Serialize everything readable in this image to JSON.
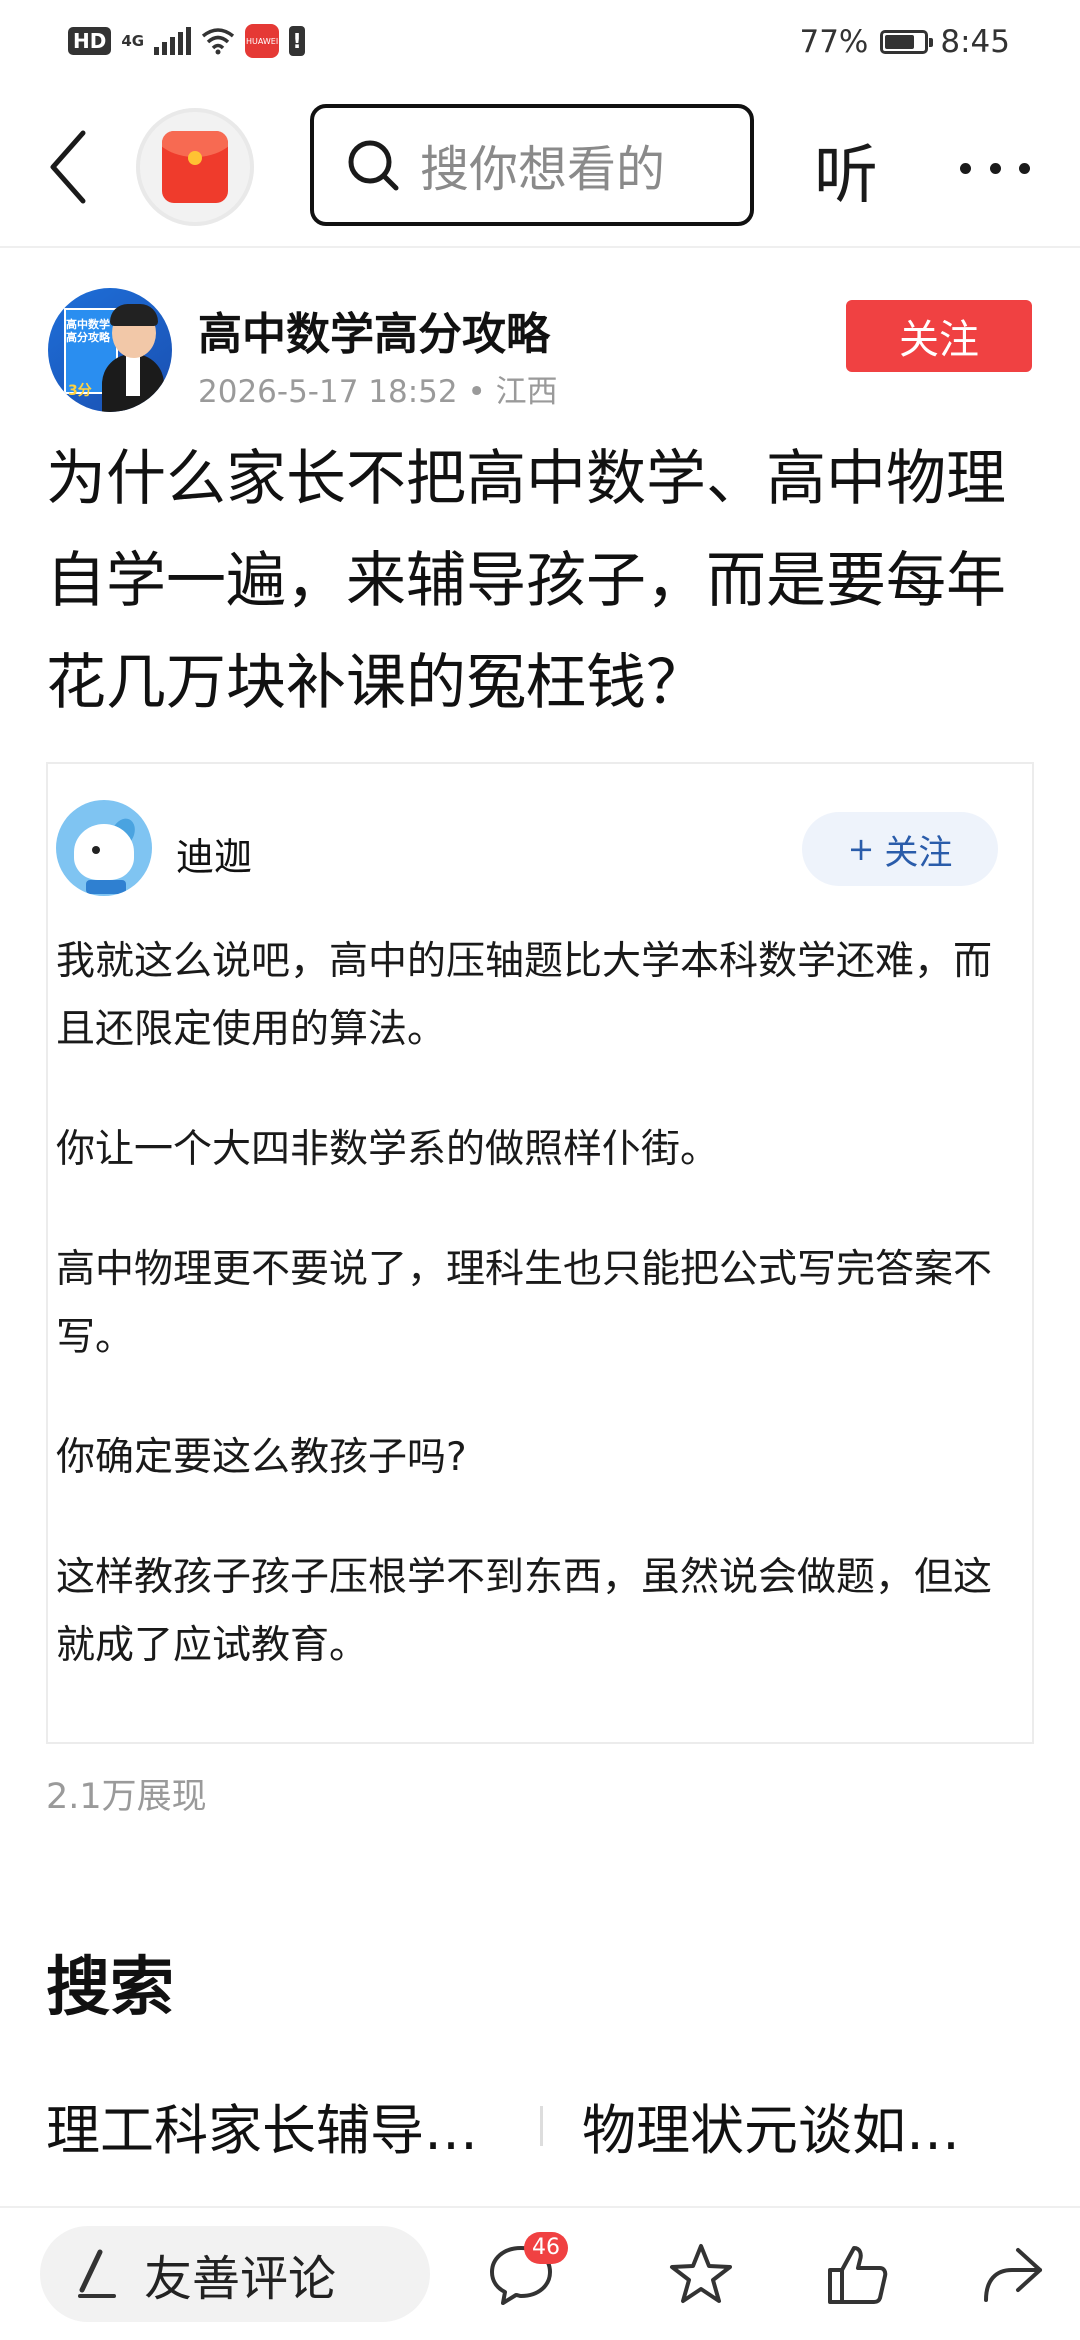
{
  "status_bar": {
    "hd": "HD",
    "network": "4G",
    "battery_percent": "77%",
    "battery_level": 0.77,
    "time": "8:45",
    "app_badge_icon": "huawei-app-icon"
  },
  "nav": {
    "back_icon": "back-chevron-icon",
    "redpack_icon": "red-envelope-icon",
    "search_placeholder": "搜你想看的",
    "listen_label": "听",
    "more_icon": "more-dots-icon"
  },
  "author": {
    "name": "高中数学高分攻略",
    "meta": "2026-5-17 18:52 • 江西",
    "follow_label": "关注",
    "avatar_text": [
      "高中数学",
      "高分攻略"
    ],
    "avatar_score": "3分"
  },
  "post": {
    "title": "为什么家长不把高中数学、高中物理自学一遍，来辅导孩子，而是要每年花几万块补课的冤枉钱？"
  },
  "answer": {
    "user_name": "迪迦",
    "follow_label": "关注",
    "follow_plus": "+",
    "paragraphs": [
      "我就这么说吧，高中的压轴题比大学本科数学还难，而且还限定使用的算法。",
      "你让一个大四非数学系的做照样仆街。",
      "高中物理更不要说了，理科生也只能把公式写完答案不写。",
      "你确定要这么教孩子吗?",
      "这样教孩子孩子压根学不到东西，虽然说会做题，但这就成了应试教育。"
    ]
  },
  "stats": {
    "views": "2.1万展现"
  },
  "related": {
    "heading": "搜索",
    "items": [
      "理工科家长辅导…",
      "物理状元谈如…"
    ]
  },
  "bottom_bar": {
    "comment_placeholder": "友善评论",
    "comment_count": "46",
    "icons": [
      "pen-icon",
      "comment-icon",
      "star-icon",
      "thumbs-up-icon",
      "share-icon"
    ]
  },
  "colors": {
    "accent_red": "#f04142",
    "follow_blue": "#2a5caa",
    "muted_text": "#9a9a9a"
  }
}
